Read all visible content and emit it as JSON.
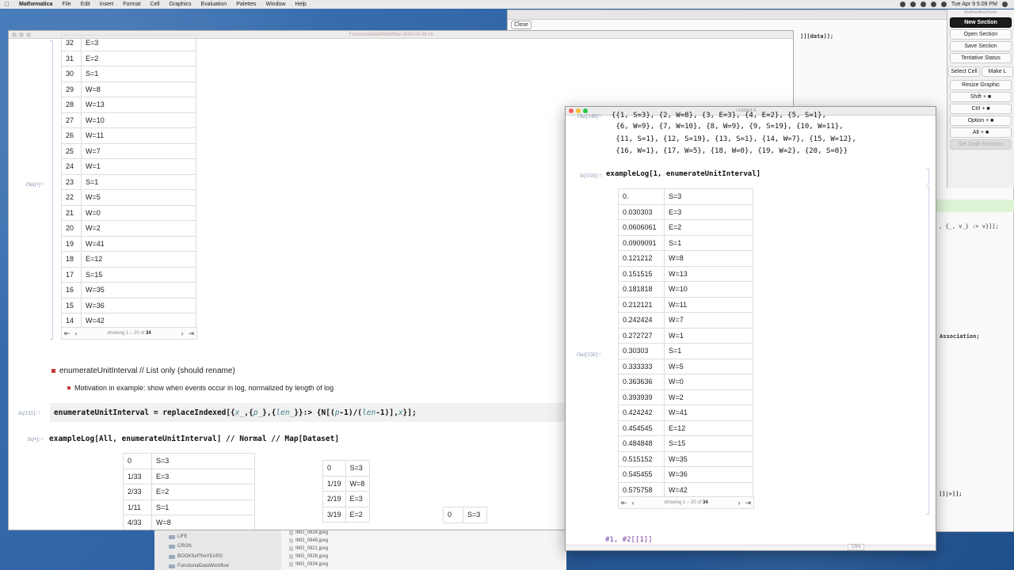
{
  "menubar": {
    "app": "Mathematica",
    "items": [
      "File",
      "Edit",
      "Insert",
      "Format",
      "Cell",
      "Graphics",
      "Evaluation",
      "Palettes",
      "Window",
      "Help"
    ],
    "clock": "Tue Apr 9  5:09 PM"
  },
  "close_button": "Close",
  "bg_window": {
    "code1": "]][data]];",
    "code2": ", {_, v_} :> v}]];",
    "code3": "Association;",
    "code4": "]]|>]];"
  },
  "palette": {
    "title": "WolframBookTools",
    "buttons": [
      "New Section",
      "Open Section",
      "Save Section",
      "Tentative Status",
      "Resize Graphic",
      "Shift + ■",
      "Ctrl + ■",
      "Option + ■",
      "Alt + ■",
      "Set Draft Sections"
    ],
    "row": [
      "Select Cell",
      "Make L"
    ]
  },
  "main": {
    "title": "FunctionalDataWorkflow-2019-04-09.nb",
    "out_label": "Out[•]=",
    "rows": [
      {
        "k": "32",
        "v": "E=3"
      },
      {
        "k": "31",
        "v": "E=2"
      },
      {
        "k": "30",
        "v": "S=1"
      },
      {
        "k": "29",
        "v": "W=8"
      },
      {
        "k": "28",
        "v": "W=13"
      },
      {
        "k": "27",
        "v": "W=10"
      },
      {
        "k": "26",
        "v": "W=11"
      },
      {
        "k": "25",
        "v": "W=7"
      },
      {
        "k": "24",
        "v": "W=1"
      },
      {
        "k": "23",
        "v": "S=1"
      },
      {
        "k": "22",
        "v": "W=5"
      },
      {
        "k": "21",
        "v": "W=0"
      },
      {
        "k": "20",
        "v": "W=2"
      },
      {
        "k": "19",
        "v": "W=41"
      },
      {
        "k": "18",
        "v": "E=12"
      },
      {
        "k": "17",
        "v": "S=15"
      },
      {
        "k": "16",
        "v": "W=35"
      },
      {
        "k": "15",
        "v": "W=36"
      },
      {
        "k": "14",
        "v": "W=42"
      }
    ],
    "pager_prefix": "showing 1 – 20 of",
    "pager_total": "34",
    "bullet1": "enumerateUnitInterval  // List only (should rename)",
    "bullet2": "Motivation in example: show when events occur in log, normalized by length of log",
    "in_label": "In[155]:=",
    "in2_label": "In[•]:=",
    "code_line2": "exampleLog[All, enumerateUnitInterval] // Normal // Map[Dataset]",
    "mini1": [
      {
        "k": "0",
        "v": "S=3"
      },
      {
        "k": "1/33",
        "v": "E=3"
      },
      {
        "k": "2/33",
        "v": "E=2"
      },
      {
        "k": "1/11",
        "v": "S=1"
      },
      {
        "k": "4/33",
        "v": "W=8"
      }
    ],
    "mini2": [
      {
        "k": "0",
        "v": "S=3"
      },
      {
        "k": "1/19",
        "v": "W=8"
      },
      {
        "k": "2/19",
        "v": "E=3"
      },
      {
        "k": "3/19",
        "v": "E=2"
      }
    ],
    "mini3": [
      {
        "k": "0",
        "v": "S=3"
      }
    ]
  },
  "untitled": {
    "title": "Untitled-6",
    "prev_out_label": "Out[148]=",
    "prev_out": [
      "{{1, S=3}, {2, W=8}, {3, E=3}, {4, E=2}, {5, S=1},",
      " {6, W=9}, {7, W=10}, {8, W=9}, {9, S=19}, {10, W=11},",
      " {11, S=1}, {12, S=19}, {13, S=1}, {14, W=7}, {15, W=12},",
      " {16, W=1}, {17, W=5}, {18, W=0}, {19, W=2}, {20, S=0}}"
    ],
    "in_label": "In[156]:=",
    "in_code": "exampleLog[1, enumerateUnitInterval]",
    "out_label": "Out[156]=",
    "rows": [
      {
        "k": "0.",
        "v": "S=3"
      },
      {
        "k": "0.030303",
        "v": "E=3"
      },
      {
        "k": "0.0606061",
        "v": "E=2"
      },
      {
        "k": "0.0909091",
        "v": "S=1"
      },
      {
        "k": "0.121212",
        "v": "W=8"
      },
      {
        "k": "0.151515",
        "v": "W=13"
      },
      {
        "k": "0.181818",
        "v": "W=10"
      },
      {
        "k": "0.212121",
        "v": "W=11"
      },
      {
        "k": "0.242424",
        "v": "W=7"
      },
      {
        "k": "0.272727",
        "v": "W=1"
      },
      {
        "k": "0.30303",
        "v": "S=1"
      },
      {
        "k": "0.333333",
        "v": "W=5"
      },
      {
        "k": "0.363636",
        "v": "W=0"
      },
      {
        "k": "0.393939",
        "v": "W=2"
      },
      {
        "k": "0.424242",
        "v": "W=41"
      },
      {
        "k": "0.454545",
        "v": "E=12"
      },
      {
        "k": "0.484848",
        "v": "S=15"
      },
      {
        "k": "0.515152",
        "v": "W=35"
      },
      {
        "k": "0.545455",
        "v": "W=36"
      },
      {
        "k": "0.575758",
        "v": "W=42"
      }
    ],
    "pager_prefix": "showing 1 – 20 of",
    "pager_total": "34",
    "bottom_code": "#1, #2[[1]]",
    "zoom": "125%"
  },
  "finder": {
    "folders": [
      "LIFE",
      "CRON",
      "BOOKSofTheYEARS",
      "FunctionalDataWorkflow"
    ],
    "files": [
      "IMG_0824.jpeg",
      "IMG_0848.jpeg",
      "IMG_0921.jpeg",
      "IMG_0928.jpeg",
      "IMG_0934.jpeg"
    ]
  }
}
